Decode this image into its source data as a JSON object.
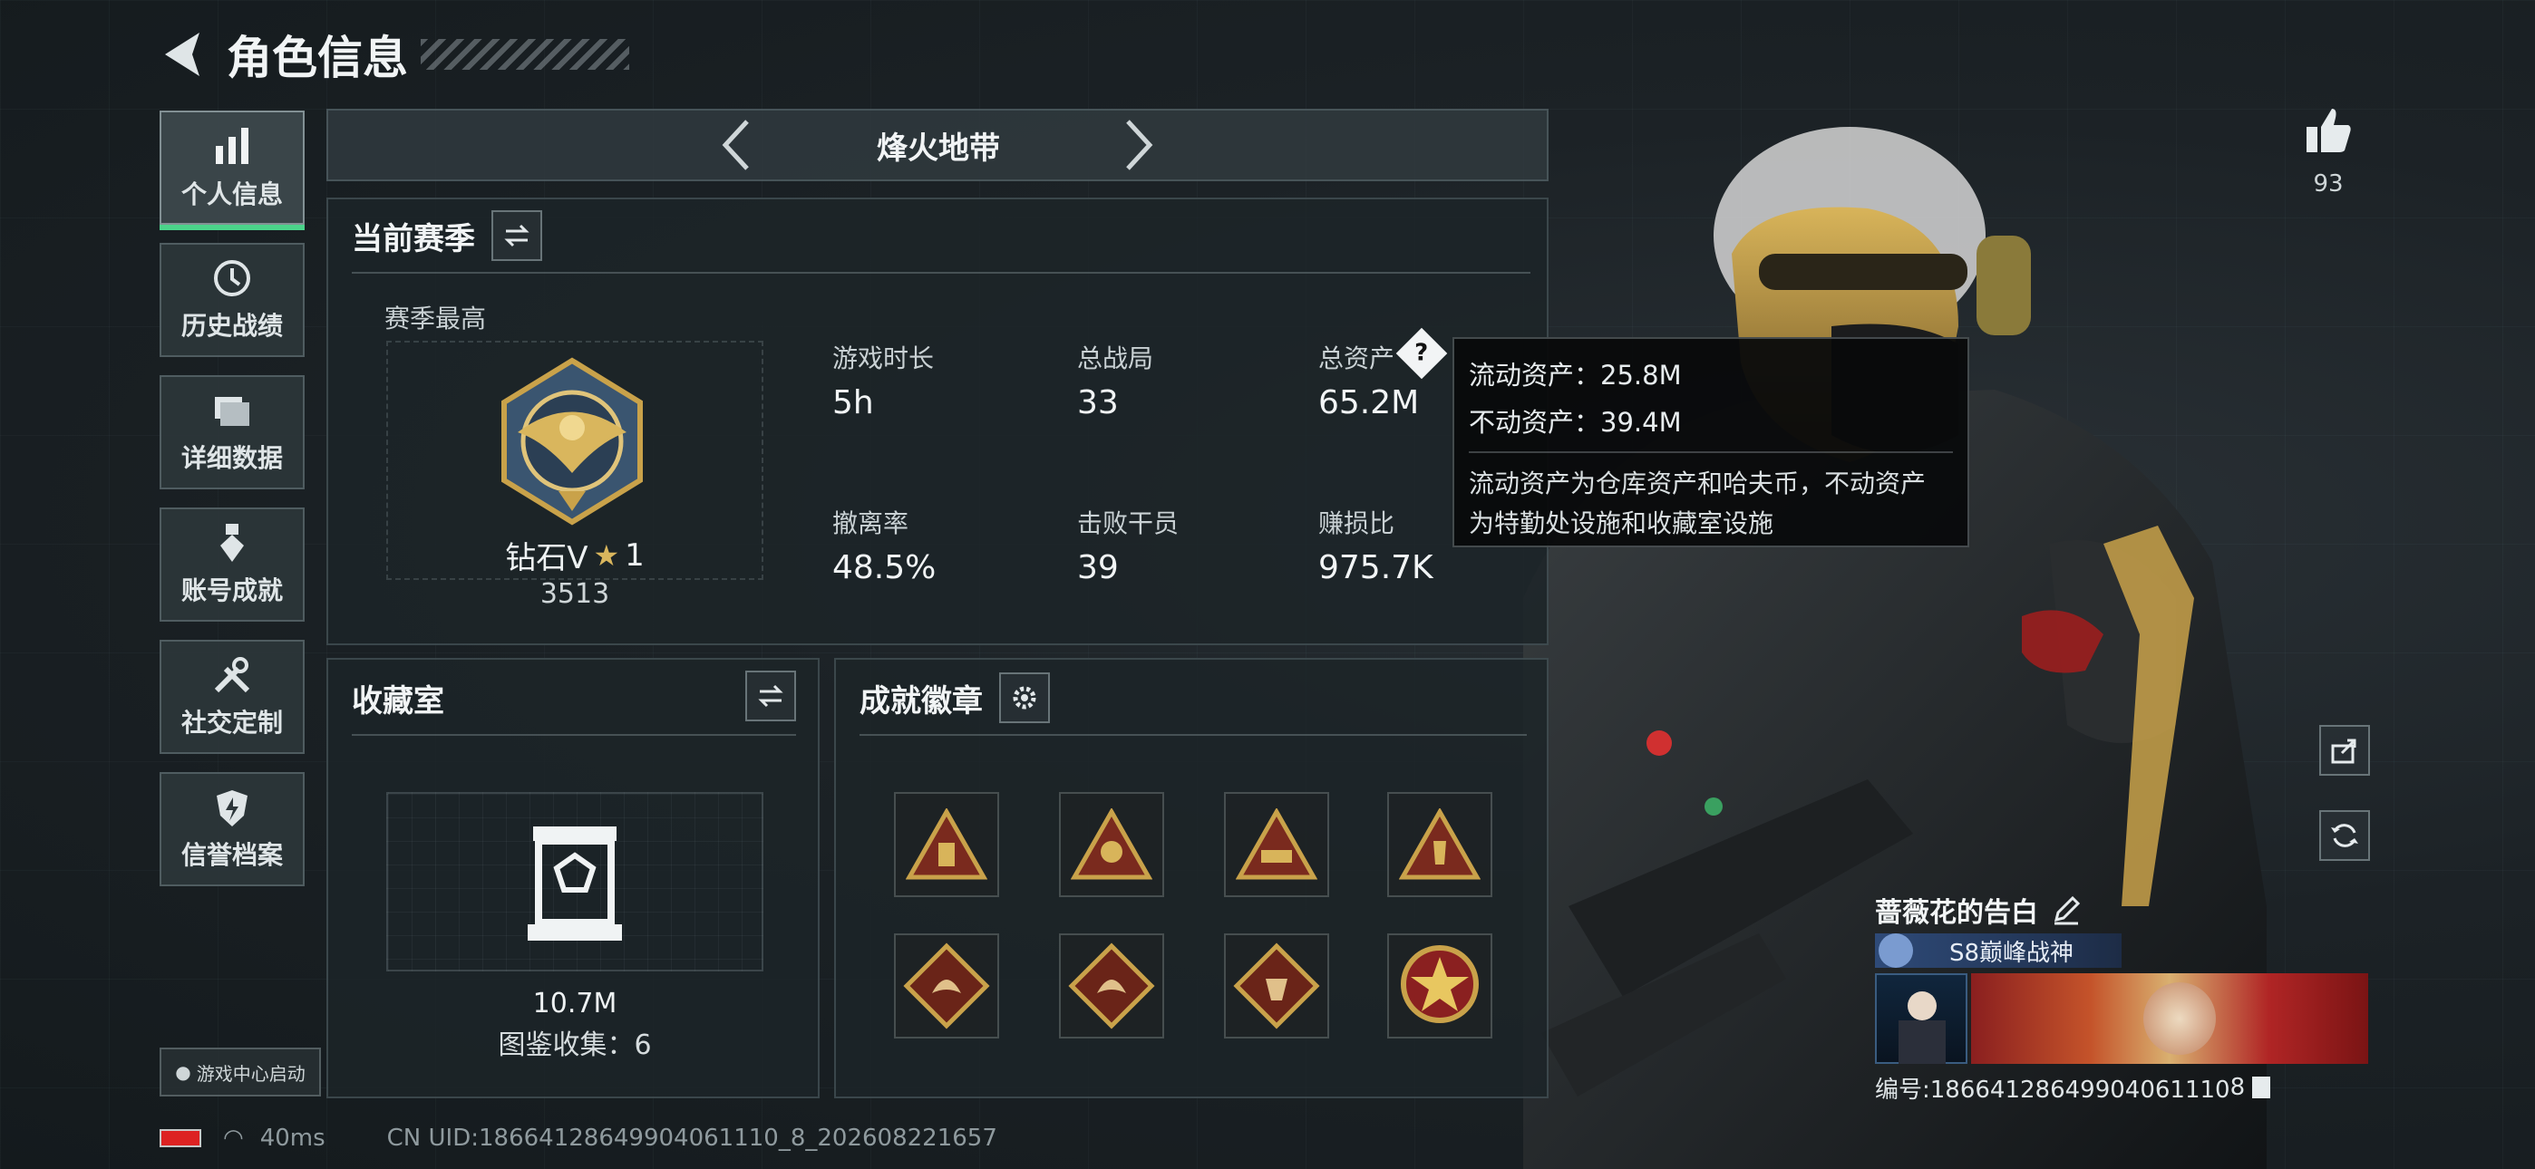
{
  "header": {
    "title": "角色信息"
  },
  "nav": [
    {
      "label": "个人信息",
      "icon": "bar-chart-icon",
      "active": true
    },
    {
      "label": "历史战绩",
      "icon": "history-icon"
    },
    {
      "label": "详细数据",
      "icon": "folder-icon"
    },
    {
      "label": "账号成就",
      "icon": "medal-icon"
    },
    {
      "label": "社交定制",
      "icon": "tools-icon"
    },
    {
      "label": "信誉档案",
      "icon": "shield-icon"
    }
  ],
  "mode_selector": {
    "label": "烽火地带"
  },
  "current_season": {
    "title": "当前赛季",
    "season_best_label": "赛季最高",
    "rank_name": "钻石V",
    "rank_stars": "1",
    "rank_score": "3513",
    "stats": [
      {
        "label": "游戏时长",
        "value": "5h"
      },
      {
        "label": "总战局",
        "value": "33"
      },
      {
        "label": "总资产",
        "value": "65.2M"
      },
      {
        "label": "撤离率",
        "value": "48.5%"
      },
      {
        "label": "击败干员",
        "value": "39"
      },
      {
        "label": "赚损比",
        "value": "975.7K"
      }
    ]
  },
  "tooltip": {
    "liquid": "流动资产：25.8M",
    "fixed": "不动资产：39.4M",
    "desc_line1": "流动资产为仓库资产和哈夫币，不动资产",
    "desc_line2": "为特勤处设施和收藏室设施"
  },
  "collection": {
    "title": "收藏室",
    "value": "10.7M",
    "subtitle": "图鉴收集：6"
  },
  "achievements": {
    "title": "成就徽章",
    "badges": [
      "triangle-badge-icon",
      "triangle-badge-icon",
      "triangle-badge-icon",
      "triangle-badge-icon",
      "diamond-badge-icon",
      "diamond-badge-icon",
      "diamond-badge-icon",
      "star-emblem-icon"
    ]
  },
  "likes": {
    "count": "93"
  },
  "profile": {
    "name": "蔷薇花的告白",
    "title_tag": "S8巅峰战神",
    "id_text": "编号:18664128649904061110",
    "id_suffix": "8"
  },
  "footer": {
    "game_center": "游戏中心启动",
    "ping": "40ms",
    "uid": "CN UID:18664128649904061110_8_202608221657"
  },
  "colors": {
    "accent_green": "#4bd38a",
    "gold": "#c9a24a"
  }
}
